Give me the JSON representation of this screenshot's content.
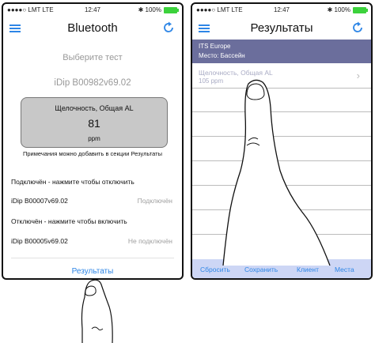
{
  "left_screen": {
    "status": {
      "carrier": "●●●●○ LMT LTE",
      "time": "12:47",
      "battery": "100%",
      "bt": "✱"
    },
    "nav": {
      "title": "Bluetooth",
      "menu_icon": "hamburger-menu-icon",
      "refresh_icon": "refresh-icon"
    },
    "choose_test": "Выберите тест",
    "device_name": "iDip  B00982v69.02",
    "test_box": {
      "name": "Щелочность, Общая AL",
      "value": "81",
      "unit": "ppm"
    },
    "note": "Примечания можно добавить в секции Результаты",
    "connected_header": "Подключён - нажмите чтобы отключить",
    "connected_device": {
      "name": "iDip  B00007v69.02",
      "status": "Подключён"
    },
    "disconnected_header": "Отключён - нажмите чтобы включить",
    "disconnected_device": {
      "name": "iDip  B00005v69.02",
      "status": "Не подключён"
    },
    "results_button": "Результаты"
  },
  "right_screen": {
    "status": {
      "carrier": "●●●●○ LMT LTE",
      "time": "12:47",
      "battery": "100%",
      "bt": "✱"
    },
    "nav": {
      "title": "Результаты",
      "menu_icon": "hamburger-menu-icon",
      "refresh_icon": "refresh-icon"
    },
    "header": {
      "line1": "ITS Europe",
      "line2": "Место: Бассейн"
    },
    "result": {
      "name": "Щелочность, Общая AL",
      "value": "105 ppm"
    },
    "toolbar": {
      "reset": "Сбросить",
      "save": "Сохранить",
      "client": "Клиент",
      "places": "Места"
    }
  },
  "colors": {
    "accent": "#2e86e6",
    "header_band": "#6b6e9c",
    "toolbar": "#cdd6f5",
    "battery": "#3cd23c",
    "test_box": "#c8c8c8"
  }
}
